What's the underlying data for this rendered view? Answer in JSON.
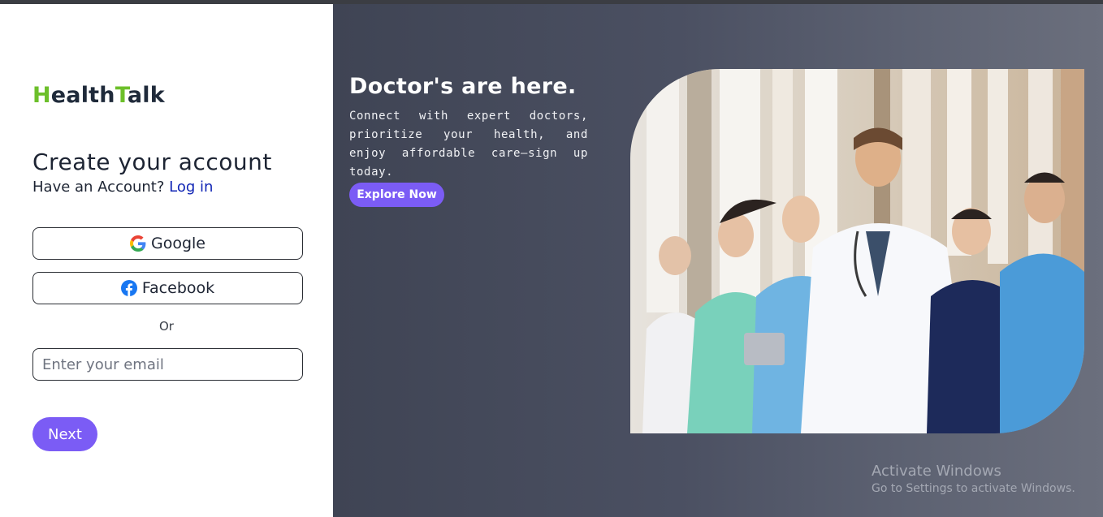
{
  "brand": {
    "part1": "H",
    "part2": "ealth",
    "part3": "T",
    "part4": "alk",
    "accent_color": "#6cbf2a"
  },
  "signup": {
    "title": "Create your account",
    "have_account": "Have an Account?",
    "login_link": "Log in",
    "google_label": "Google",
    "facebook_label": "Facebook",
    "or_label": "Or",
    "email_placeholder": "Enter your email",
    "next_label": "Next"
  },
  "hero": {
    "title": "Doctor's are here.",
    "text": "Connect with expert doctors, prioritize your health, and enjoy affordable care—sign up today.",
    "cta_label": "Explore Now",
    "image_icon": "doctors-team-photo"
  },
  "watermark": {
    "title": "Activate Windows",
    "subtitle": "Go to Settings to activate Windows."
  },
  "colors": {
    "primary": "#7b5cf5",
    "link": "#1126b5",
    "panel_dark": "#454a5a",
    "brand_green": "#6cbf2a"
  }
}
